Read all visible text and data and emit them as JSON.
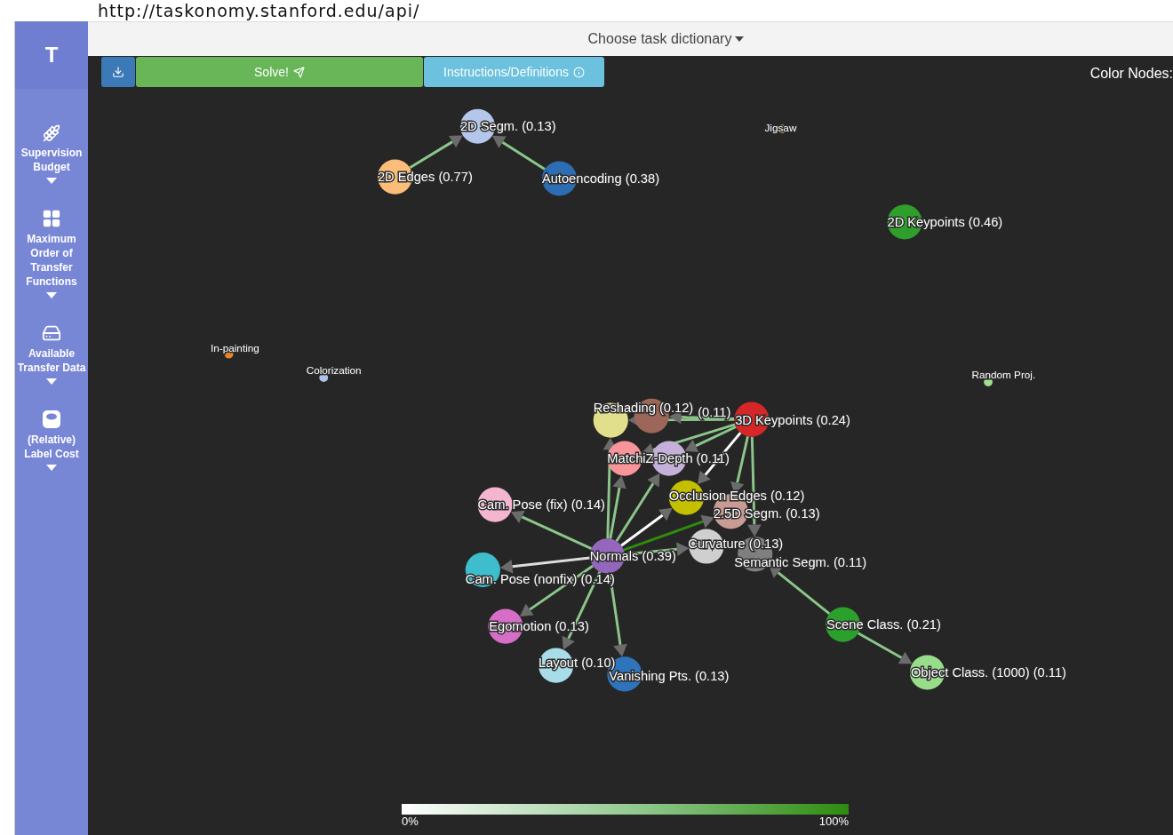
{
  "url_overlay": "http://taskonomy.stanford.edu/api/",
  "sidebar": {
    "logo": "T",
    "items": [
      {
        "label": "Supervision Budget"
      },
      {
        "label": "Maximum Order of Transfer Functions"
      },
      {
        "label": "Available Transfer Data"
      },
      {
        "label": "(Relative) Label Cost"
      }
    ]
  },
  "title_dropdown": "Choose task dictionary",
  "toolbar": {
    "buttons": [
      {
        "kind": "download"
      },
      {
        "kind": "solve",
        "label": "Solve!"
      },
      {
        "kind": "info",
        "label": "Instructions/Definitions"
      }
    ],
    "color_nodes_label": "Color Nodes:"
  },
  "graph": {
    "nodes": [
      {
        "kind": "task",
        "label": "2D Segm. (0.13)",
        "color": "#b4c6ea"
      },
      {
        "kind": "task",
        "label": "2D Edges (0.77)",
        "color": "#fbbd78"
      },
      {
        "kind": "task",
        "label": "Autoencoding (0.38)",
        "color": "#2c6db3"
      },
      {
        "kind": "dot",
        "label": "Jigsaw",
        "color": "#f0a040"
      },
      {
        "kind": "task",
        "label": "2D Keypoints (0.46)",
        "color": "#2f9e2a"
      },
      {
        "kind": "dot",
        "label": "In-painting",
        "color": "#e6842a"
      },
      {
        "kind": "dot",
        "label": "Colorization",
        "color": "#a9c4e8"
      },
      {
        "kind": "dot",
        "label": "Random Proj.",
        "color": "#9fe08f"
      },
      {
        "kind": "task",
        "label": "(0.11)",
        "color": "#9c6658"
      },
      {
        "kind": "task",
        "label": "Reshading (0.12)",
        "color": "#e2df8c"
      },
      {
        "kind": "task",
        "label": "3D Keypoints (0.24)",
        "color": "#d62728"
      },
      {
        "kind": "task",
        "label": "MatchiZ-Depth (0.11)",
        "color": "#f7959a"
      },
      {
        "kind": "task",
        "color": "#c4b0d8"
      },
      {
        "kind": "task",
        "label": "Occlusion Edges (0.12)",
        "color": "#c4c000"
      },
      {
        "kind": "task",
        "label": "2.5D Segm. (0.13)",
        "color": "#c99c93"
      },
      {
        "kind": "task",
        "label": "Curvature (0.13)",
        "color": "#cfcfcf"
      },
      {
        "kind": "task",
        "label": "Semantic Segm. (0.11)",
        "color": "#7f7f7f"
      },
      {
        "kind": "task",
        "label": "Cam. Pose (fix) (0.14)",
        "color": "#f4b5d0"
      },
      {
        "kind": "task",
        "label": "Normals (0.39)",
        "color": "#9467bd"
      },
      {
        "kind": "task",
        "label": "Cam. Pose (nonfix) (0.14)",
        "color": "#3ebdcc"
      },
      {
        "kind": "task",
        "label": "Egomotion (0.13)",
        "color": "#d66dc6"
      },
      {
        "kind": "task",
        "label": "Layout (0.10)",
        "color": "#a8dce9"
      },
      {
        "kind": "task",
        "label": "Vanishing Pts. (0.13)",
        "color": "#2e74bd"
      },
      {
        "kind": "task",
        "label": "Scene Class. (0.21)",
        "color": "#2ca02c"
      },
      {
        "kind": "task",
        "label": "Object Class. (1000) (0.11)",
        "color": "#98de8a"
      }
    ],
    "edges": [
      {
        "color": "#8cc68a"
      },
      {
        "color": "#8cc68a"
      },
      {
        "color": "#8cc68a"
      },
      {
        "color": "#dddddd"
      },
      {
        "color": "#8cc68a"
      },
      {
        "color": "#8cc68a"
      },
      {
        "color": "#8cc68a"
      },
      {
        "color": "#8cc68a"
      },
      {
        "color": "#8cc68a"
      },
      {
        "color": "#8cc68a"
      },
      {
        "color": "#ffffff"
      },
      {
        "color": "#2e8b0e"
      },
      {
        "color": "#8cc68a"
      },
      {
        "color": "#8cc68a"
      },
      {
        "color": "#8cc68a"
      },
      {
        "color": "#8cc68a"
      },
      {
        "color": "#8cc68a"
      },
      {
        "color": "#ffffff"
      },
      {
        "color": "#8cc68a"
      },
      {
        "color": "#8cc68a"
      },
      {
        "color": "#8cc68a"
      },
      {
        "color": "#8cc68a"
      }
    ]
  },
  "legend": {
    "min_label": "0%",
    "max_label": "100%"
  }
}
